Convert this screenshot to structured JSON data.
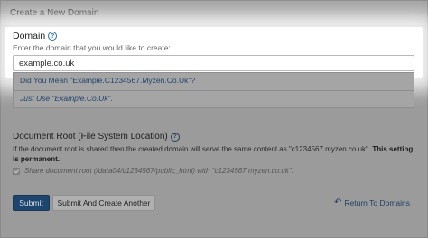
{
  "panel": {
    "title": "Create a New Domain"
  },
  "domain": {
    "label": "Domain",
    "help_icon": "question-circle-icon",
    "hint": "Enter the domain that you would like to create:",
    "value": "example.co.uk",
    "suggestions": [
      "Did You Mean \"Example.C1234567.Myzen.Co.Uk\"?",
      "Just Use \"Example.Co.Uk\"."
    ]
  },
  "document_root": {
    "label": "Document Root (File System Location)",
    "help_icon": "question-circle-icon",
    "desc_prefix": "If the document root is shared then the created domain will serve the same content as \"c1234567.myzen.co.uk\".",
    "desc_bold": "This setting is permanent.",
    "share_label": "Share document root (/data04/c1234567/public_html) with \"c1234567.myzen.co.uk\"."
  },
  "actions": {
    "submit_label": "Submit",
    "submit_another_label": "Submit And Create Another",
    "return_label": "Return To Domains",
    "return_icon": "undo-arrow-icon"
  },
  "colors": {
    "overlay": "#9b9b9b",
    "spotlight": "#ffffff",
    "primary_button": "#1d456e",
    "link": "#1f3f63"
  }
}
